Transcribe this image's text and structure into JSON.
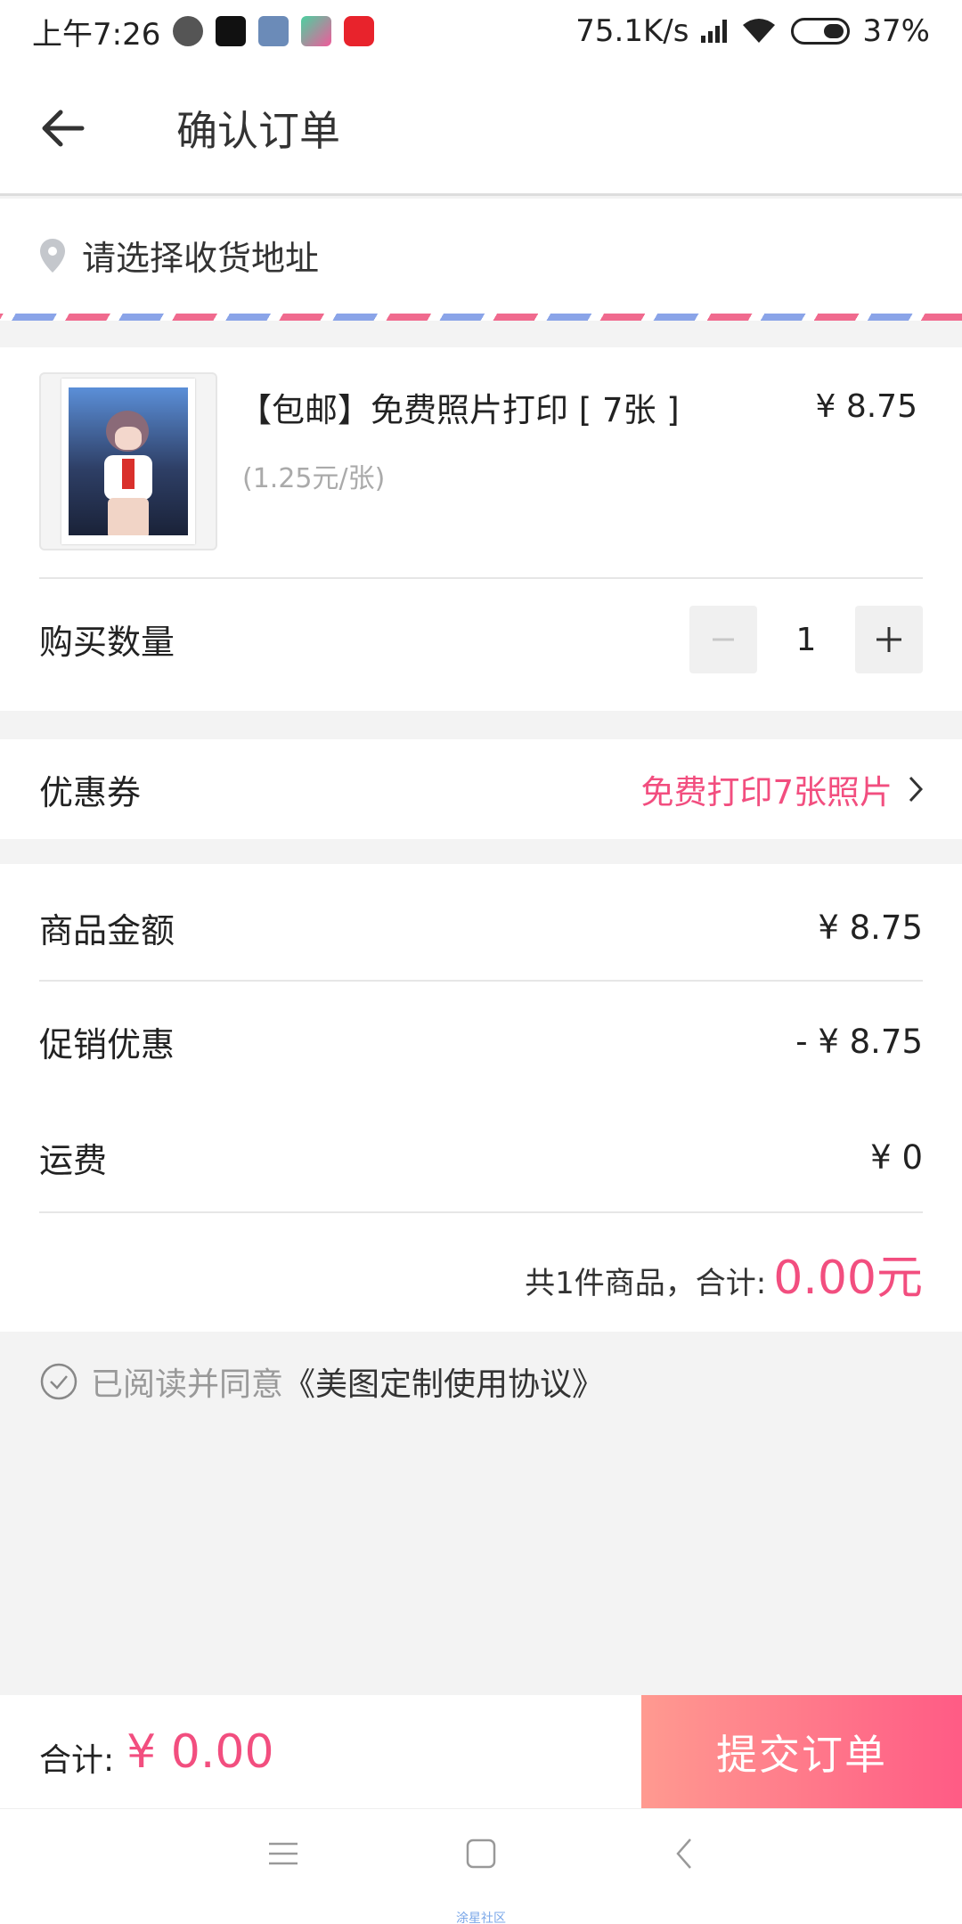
{
  "status_bar": {
    "time": "上午7:26",
    "network_speed": "75.1K/s",
    "battery": "37%",
    "icons": [
      "app-icon-1",
      "tiktok-icon",
      "gallery-icon",
      "video-icon",
      "music-icon",
      "signal-icon",
      "wifi-icon",
      "battery-icon"
    ]
  },
  "header": {
    "title": "确认订单",
    "back_icon": "arrow-left-icon"
  },
  "address": {
    "placeholder": "请选择收货地址",
    "icon": "location-pin-icon"
  },
  "product": {
    "name": "【包邮】免费照片打印 [ 7张 ]",
    "price": "¥ 8.75",
    "unit_price": "(1.25元/张)",
    "quantity_label": "购买数量",
    "quantity": "1"
  },
  "coupon": {
    "label": "优惠券",
    "value": "免费打印7张照片"
  },
  "summary": {
    "subtotal_label": "商品金额",
    "subtotal": "¥ 8.75",
    "discount_label": "促销优惠",
    "discount": "- ¥ 8.75",
    "shipping_label": "运费",
    "shipping": "¥ 0",
    "total_label": "共1件商品，合计:",
    "total": "0.00元"
  },
  "agreement": {
    "prefix": "已阅读并同意",
    "link": "《美图定制使用协议》"
  },
  "bottom_bar": {
    "label": "合计:",
    "amount": "¥ 0.00",
    "submit": "提交订单"
  },
  "watermark": "涂星社区",
  "colors": {
    "accent": "#f24e7f",
    "submit_start": "#ff9a90",
    "submit_end": "#ff5b85"
  }
}
